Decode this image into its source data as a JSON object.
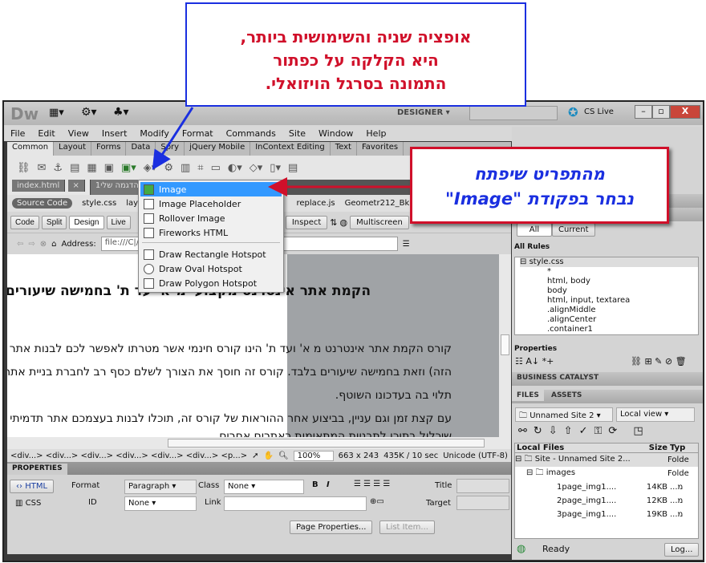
{
  "app": {
    "logo": "Dw",
    "workspace": "DESIGNER",
    "cs_live": "CS Live"
  },
  "menu": [
    "File",
    "Edit",
    "View",
    "Insert",
    "Modify",
    "Format",
    "Commands",
    "Site",
    "Window",
    "Help"
  ],
  "insert_tabs": [
    "Common",
    "Layout",
    "Forms",
    "Data",
    "Spry",
    "jQuery Mobile",
    "InContext Editing",
    "Text",
    "Favorites"
  ],
  "doc_tabs": [
    "index.html",
    "הדגמה שלי1.html"
  ],
  "related": {
    "source": "Source Code",
    "files": [
      "style.css",
      "layout.css",
      "replace.js",
      "Geometr212_BkCn_BT_400.font.js"
    ]
  },
  "doc_toolbar": {
    "code": "Code",
    "split": "Split",
    "design": "Design",
    "live": "Live",
    "inspect": "Inspect",
    "multiscreen": "Multiscreen"
  },
  "address": {
    "label": "Address:",
    "value": "file:///C|/מדריך/תבניות/הקמת-אתר/index.html"
  },
  "dropdown": {
    "items": [
      "Image",
      "Image Placeholder",
      "Rollover Image",
      "Fireworks HTML",
      "Draw Rectangle Hotspot",
      "Draw Oval Hotspot",
      "Draw Polygon Hotspot"
    ],
    "selected": "Image"
  },
  "content": {
    "heading": "הקמת אתר אינטרנט מקצועי מ-א' עד ת' בחמישה שיעורים",
    "p1": [
      "קורס הקמת אתר אינטרנט מ א' ועד ת' הינו קורס חינמי אשר מטרתו לאפשר לכם לבנות אתר תדמיתי",
      "הזה) וזאת בחמישה שיעורים בלבד. קורס זה חוסך את הצורך לשלם כסף רב לחברת בניית אתרים",
      "תלוי בה בעדכונו השוטף."
    ],
    "p2": [
      "עם קצת זמן וגם עניין, בביצוע אחר ההוראות של קורס זה, תוכלו לבנות בעצמכם אתר תדמיתי מקצועי",
      "שיכלול בתוכו לתבניות המתאימות כאתרים אחרים"
    ]
  },
  "status": {
    "tags": "<div...> <div...> <div...> <div...> <div...> <div...> <p...>",
    "zoom": "100%",
    "size": "663 x 243",
    "download": "435K / 10 sec",
    "encoding": "Unicode (UTF-8)"
  },
  "properties": {
    "title": "PROPERTIES",
    "html": "HTML",
    "css": "CSS",
    "format_label": "Format",
    "format": "Paragraph",
    "class_label": "Class",
    "class": "None",
    "id_label": "ID",
    "id": "None",
    "link_label": "Link",
    "title_label": "Title",
    "target_label": "Target",
    "page_props": "Page Properties...",
    "list_item": "List Item..."
  },
  "css_panel": {
    "all": "All",
    "current": "Current",
    "all_rules": "All Rules",
    "rules": [
      "style.css",
      "*",
      "html, body",
      "body",
      "html, input, textarea",
      ".alignMiddle",
      ".alignCenter",
      ".container1"
    ],
    "properties": "Properties"
  },
  "business_catalyst": "BUSINESS CATALYST",
  "files": {
    "tab_files": "FILES",
    "tab_assets": "ASSETS",
    "site": "Unnamed Site 2",
    "view": "Local view",
    "col_local": "Local Files",
    "col_size": "Size",
    "col_type": "Typ",
    "rows": [
      {
        "name": "Site - Unnamed Site 2...",
        "size": "",
        "type": "Folde"
      },
      {
        "name": "images",
        "size": "",
        "type": "Folde"
      },
      {
        "name": "1page_img1....",
        "size": "14KB",
        "type": "...מ"
      },
      {
        "name": "2page_img1....",
        "size": "12KB",
        "type": "...מ"
      },
      {
        "name": "3page_img1....",
        "size": "19KB",
        "type": "...מ"
      }
    ],
    "status": "Ready",
    "log": "Log..."
  },
  "callouts": {
    "top": [
      "אופציה שניה והשימושית ביותר,",
      "היא הקלקה על כפתור",
      "התמונה בסרגל הויזואלי."
    ],
    "right": [
      "מהתפריט שיפתח",
      "נבחר בפקודת \"Image\""
    ]
  },
  "colors": {
    "callout_red": "#d0102a",
    "callout_blue": "#1a2fe0",
    "menu_highlight": "#3399ff"
  }
}
